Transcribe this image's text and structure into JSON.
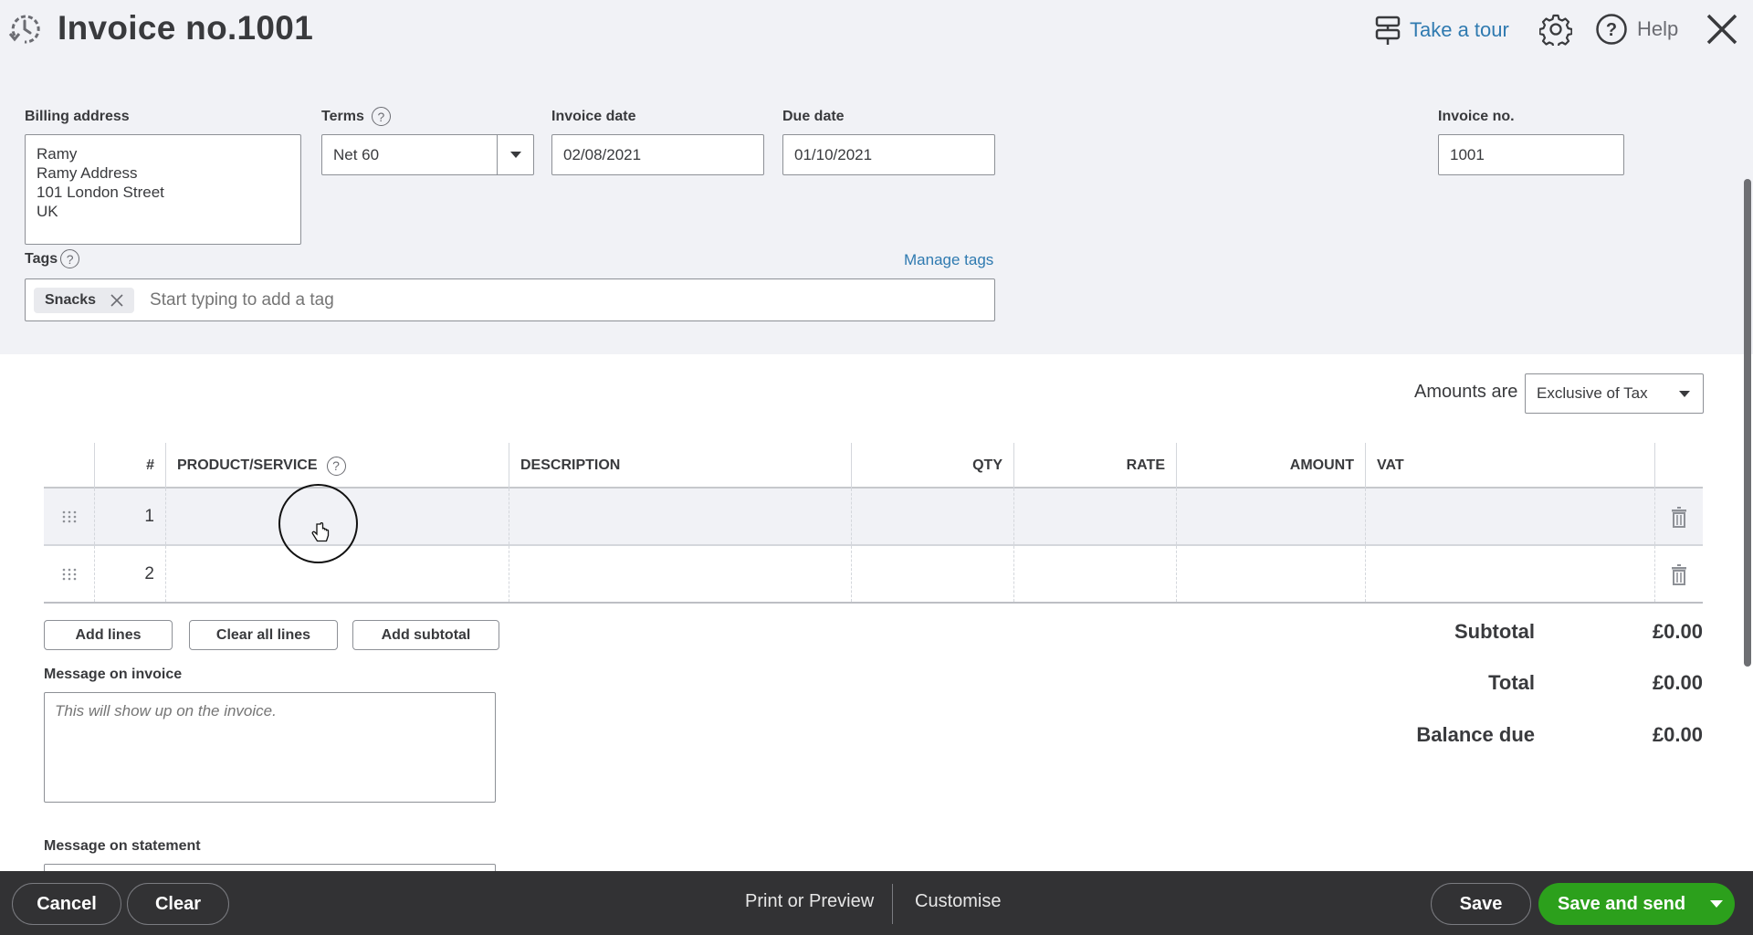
{
  "header": {
    "title": "Invoice no.1001",
    "take_tour": "Take a tour",
    "help": "Help"
  },
  "form": {
    "billing_address": {
      "label": "Billing address",
      "lines": [
        "Ramy",
        "Ramy Address",
        "101 London Street",
        "UK"
      ]
    },
    "terms": {
      "label": "Terms",
      "value": "Net 60"
    },
    "invoice_date": {
      "label": "Invoice date",
      "value": "02/08/2021"
    },
    "due_date": {
      "label": "Due date",
      "value": "01/10/2021"
    },
    "invoice_no": {
      "label": "Invoice no.",
      "value": "1001"
    },
    "tags": {
      "label": "Tags",
      "manage_label": "Manage tags",
      "chips": [
        "Snacks"
      ],
      "placeholder": "Start typing to add a tag"
    }
  },
  "amounts": {
    "label": "Amounts are",
    "value": "Exclusive of Tax"
  },
  "table": {
    "columns": [
      "#",
      "PRODUCT/SERVICE",
      "DESCRIPTION",
      "QTY",
      "RATE",
      "AMOUNT",
      "VAT"
    ],
    "rows": [
      {
        "num": "1",
        "product": "",
        "description": "",
        "qty": "",
        "rate": "",
        "amount": "",
        "vat": ""
      },
      {
        "num": "2",
        "product": "",
        "description": "",
        "qty": "",
        "rate": "",
        "amount": "",
        "vat": ""
      }
    ]
  },
  "line_actions": {
    "add_lines": "Add lines",
    "clear_all_lines": "Clear all lines",
    "add_subtotal": "Add subtotal"
  },
  "messages": {
    "invoice_label": "Message on invoice",
    "invoice_placeholder": "This will show up on the invoice.",
    "statement_label": "Message on statement"
  },
  "totals": {
    "subtotal_label": "Subtotal",
    "subtotal": "£0.00",
    "total_label": "Total",
    "total": "£0.00",
    "balance_label": "Balance due",
    "balance": "£0.00"
  },
  "footer": {
    "cancel": "Cancel",
    "clear": "Clear",
    "print_preview": "Print or Preview",
    "customise": "Customise",
    "save": "Save",
    "save_and_send": "Save and send"
  },
  "colors": {
    "accent_green": "#2ca01c",
    "link_blue": "#2f7ab0",
    "footer_bg": "#323234",
    "header_bg": "#f1f2f6"
  }
}
